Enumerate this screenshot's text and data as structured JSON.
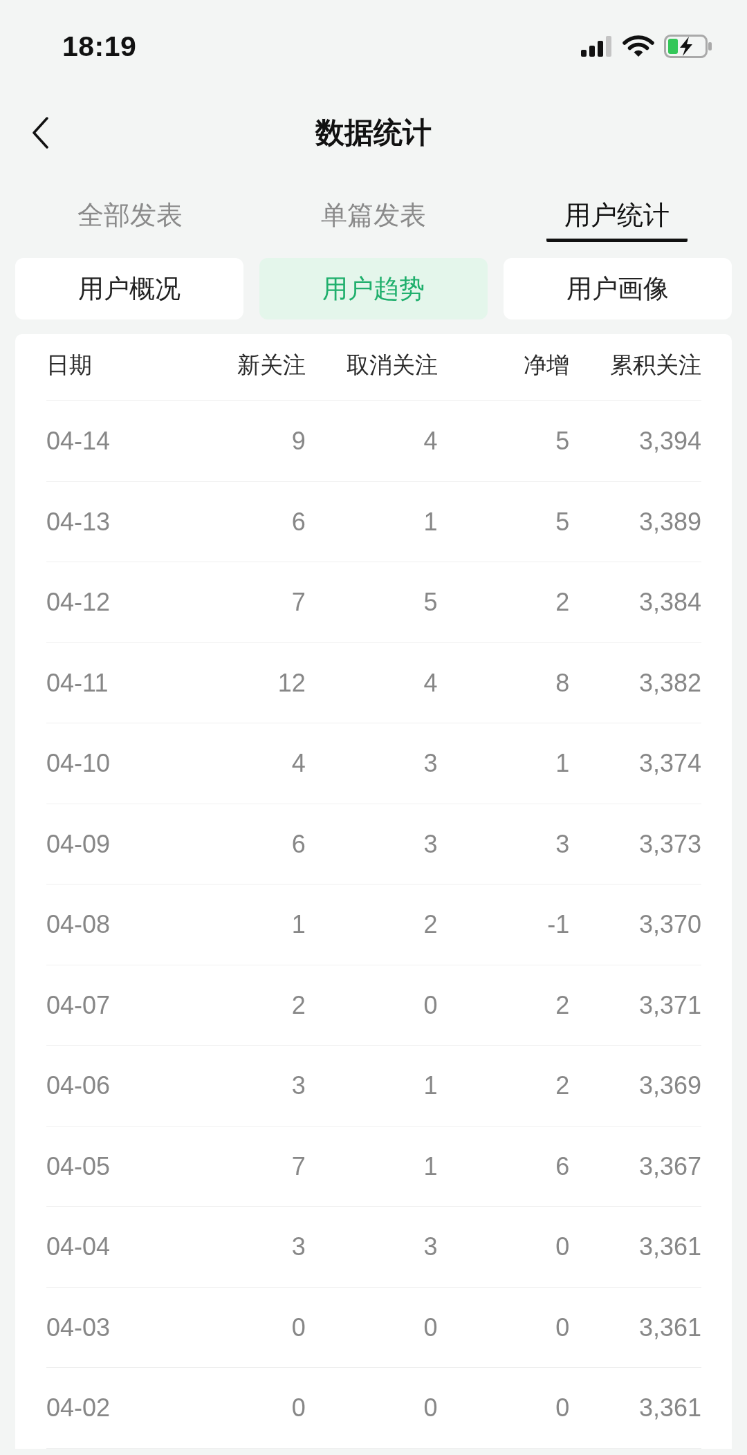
{
  "status_bar": {
    "time": "18:19"
  },
  "header": {
    "title": "数据统计"
  },
  "tabs": [
    {
      "label": "全部发表",
      "selected": false
    },
    {
      "label": "单篇发表",
      "selected": false
    },
    {
      "label": "用户统计",
      "selected": true
    }
  ],
  "sub_tabs": [
    {
      "label": "用户概况",
      "selected": false
    },
    {
      "label": "用户趋势",
      "selected": true
    },
    {
      "label": "用户画像",
      "selected": false
    }
  ],
  "table": {
    "columns": [
      "日期",
      "新关注",
      "取消关注",
      "净增",
      "累积关注"
    ],
    "rows": [
      [
        "04-14",
        "9",
        "4",
        "5",
        "3,394"
      ],
      [
        "04-13",
        "6",
        "1",
        "5",
        "3,389"
      ],
      [
        "04-12",
        "7",
        "5",
        "2",
        "3,384"
      ],
      [
        "04-11",
        "12",
        "4",
        "8",
        "3,382"
      ],
      [
        "04-10",
        "4",
        "3",
        "1",
        "3,374"
      ],
      [
        "04-09",
        "6",
        "3",
        "3",
        "3,373"
      ],
      [
        "04-08",
        "1",
        "2",
        "-1",
        "3,370"
      ],
      [
        "04-07",
        "2",
        "0",
        "2",
        "3,371"
      ],
      [
        "04-06",
        "3",
        "1",
        "2",
        "3,369"
      ],
      [
        "04-05",
        "7",
        "1",
        "6",
        "3,367"
      ],
      [
        "04-04",
        "3",
        "3",
        "0",
        "3,361"
      ],
      [
        "04-03",
        "0",
        "0",
        "0",
        "3,361"
      ],
      [
        "04-02",
        "0",
        "0",
        "0",
        "3,361"
      ]
    ]
  }
}
